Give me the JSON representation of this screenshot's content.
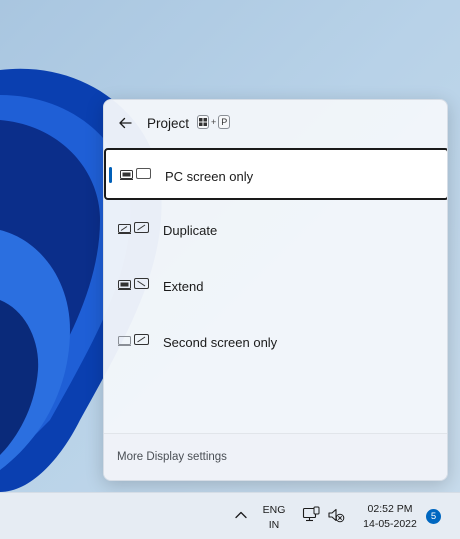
{
  "flyout": {
    "title": "Project",
    "shortcut": {
      "key1_icon": "windows-key-icon",
      "plus": "+",
      "key2": "P"
    },
    "options": [
      {
        "label": "PC screen only",
        "icon": "pc-screen-only-icon",
        "selected": true
      },
      {
        "label": "Duplicate",
        "icon": "duplicate-icon",
        "selected": false
      },
      {
        "label": "Extend",
        "icon": "extend-icon",
        "selected": false
      },
      {
        "label": "Second screen only",
        "icon": "second-screen-only-icon",
        "selected": false
      }
    ],
    "footer_link": "More Display settings"
  },
  "taskbar": {
    "lang_line1": "ENG",
    "lang_line2": "IN",
    "time": "02:52 PM",
    "date": "14-05-2022",
    "notification_count": "5"
  },
  "colors": {
    "accent": "#005fb8",
    "badge": "#0067c0"
  }
}
